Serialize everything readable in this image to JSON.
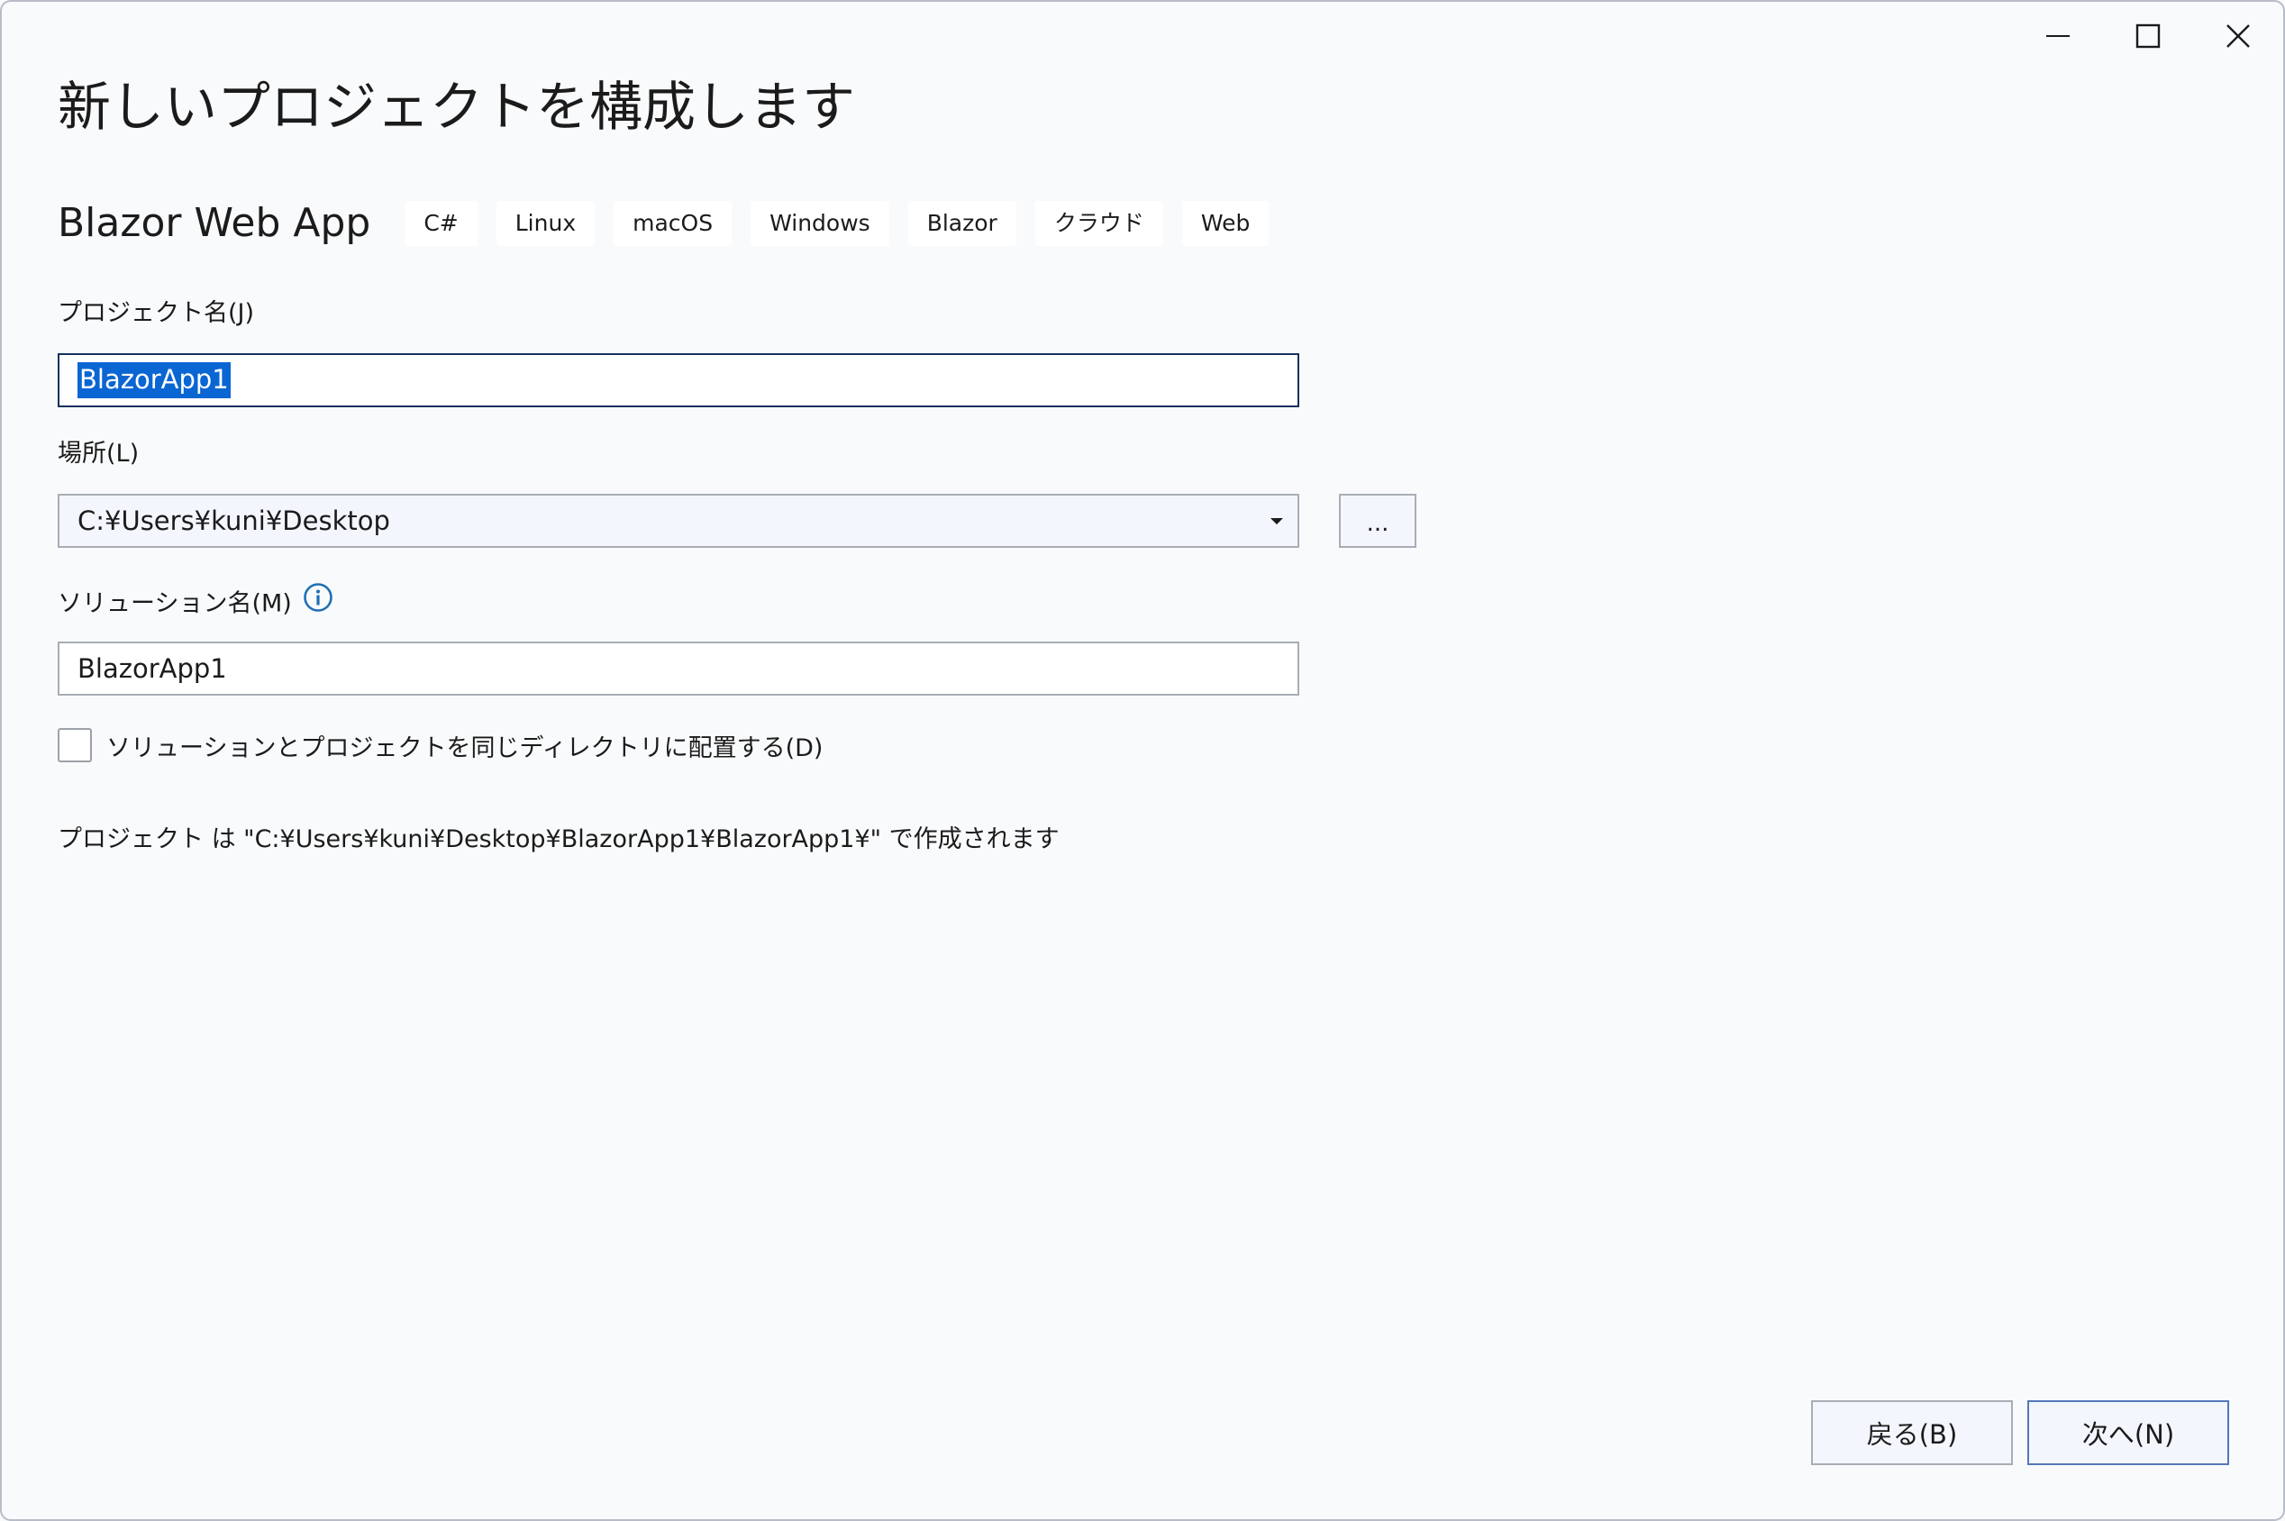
{
  "window": {
    "controls": {
      "minimize_icon": "minimize-icon",
      "maximize_icon": "maximize-icon",
      "close_icon": "close-icon"
    }
  },
  "page_title": "新しいプロジェクトを構成します",
  "template": {
    "name": "Blazor Web App",
    "tags": [
      "C#",
      "Linux",
      "macOS",
      "Windows",
      "Blazor",
      "クラウド",
      "Web"
    ]
  },
  "project_name": {
    "label": "プロジェクト名(J)",
    "value": "BlazorApp1"
  },
  "location": {
    "label": "場所(L)",
    "value": "C:¥Users¥kuni¥Desktop",
    "browse_label": "..."
  },
  "solution_name": {
    "label": "ソリューション名(M)",
    "value": "BlazorApp1",
    "info_icon": "info-icon"
  },
  "same_directory": {
    "label": "ソリューションとプロジェクトを同じディレクトリに配置する(D)",
    "checked": false
  },
  "path_note": "プロジェクト は \"C:¥Users¥kuni¥Desktop¥BlazorApp1¥BlazorApp1¥\" で作成されます",
  "footer": {
    "back_label": "戻る(B)",
    "next_label": "次へ(N)"
  },
  "colors": {
    "background": "#f9fafc",
    "selection": "#0a66d3",
    "focus_border": "#16305f",
    "info_icon": "#1f6fb5",
    "primary_button_border": "#5478b8"
  }
}
